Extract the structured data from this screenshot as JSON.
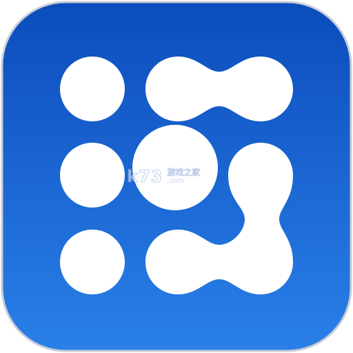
{
  "app_icon": {
    "name": "dots-network-app-icon",
    "background_top": "#0c4cbc",
    "background_bottom": "#2a80e8",
    "border_color": "#c8cdd6",
    "shape_color": "#ffffff"
  },
  "watermark": {
    "logo_text": "k73",
    "site_cn": "游戏之家",
    "site_domain": ".com"
  }
}
